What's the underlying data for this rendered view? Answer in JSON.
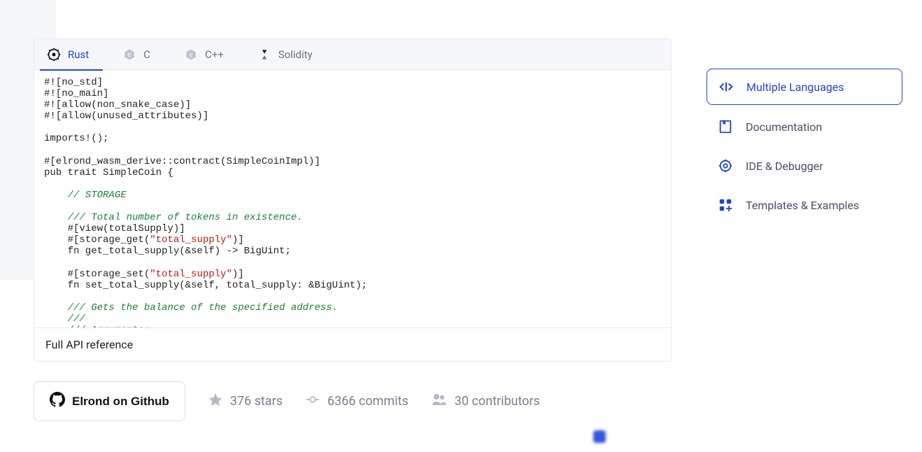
{
  "tabs": [
    {
      "label": "Rust",
      "active": true
    },
    {
      "label": "C",
      "active": false
    },
    {
      "label": "C++",
      "active": false
    },
    {
      "label": "Solidity",
      "active": false
    }
  ],
  "code": {
    "line1": "#![no_std]",
    "line2": "#![no_main]",
    "line3": "#![allow(non_snake_case)]",
    "line4": "#![allow(unused_attributes)]",
    "line5": "",
    "line6": "imports!();",
    "line7": "",
    "line8": "#[elrond_wasm_derive::contract(SimpleCoinImpl)]",
    "line9": "pub trait SimpleCoin {",
    "line10": "",
    "comment1": "    // STORAGE",
    "line12": "",
    "comment2": "    /// Total number of tokens in existence.",
    "attr_view_a": "    #[view(totalSupply)]",
    "attr_sg_a": "    #[storage_get(",
    "str_total_supply": "\"total_supply\"",
    "attr_close": ")]",
    "fn1": "    fn get_total_supply(&self) -> BigUint;",
    "line17": "",
    "attr_ss_a": "    #[storage_set(",
    "fn2": "    fn set_total_supply(&self, total_supply: &BigUint);",
    "line20": "",
    "comment3": "    /// Gets the balance of the specified address.",
    "comment4": "    ///",
    "comment5": "    /// Arguments:"
  },
  "api_ref_label": "Full API reference",
  "github_button": "Elrond on Github",
  "stats": {
    "stars": "376 stars",
    "commits": "6366 commits",
    "contributors": "30 contributors"
  },
  "sidebar": {
    "items": [
      {
        "label": "Multiple Languages",
        "active": true
      },
      {
        "label": "Documentation",
        "active": false
      },
      {
        "label": "IDE & Debugger",
        "active": false
      },
      {
        "label": "Templates & Examples",
        "active": false
      }
    ]
  }
}
